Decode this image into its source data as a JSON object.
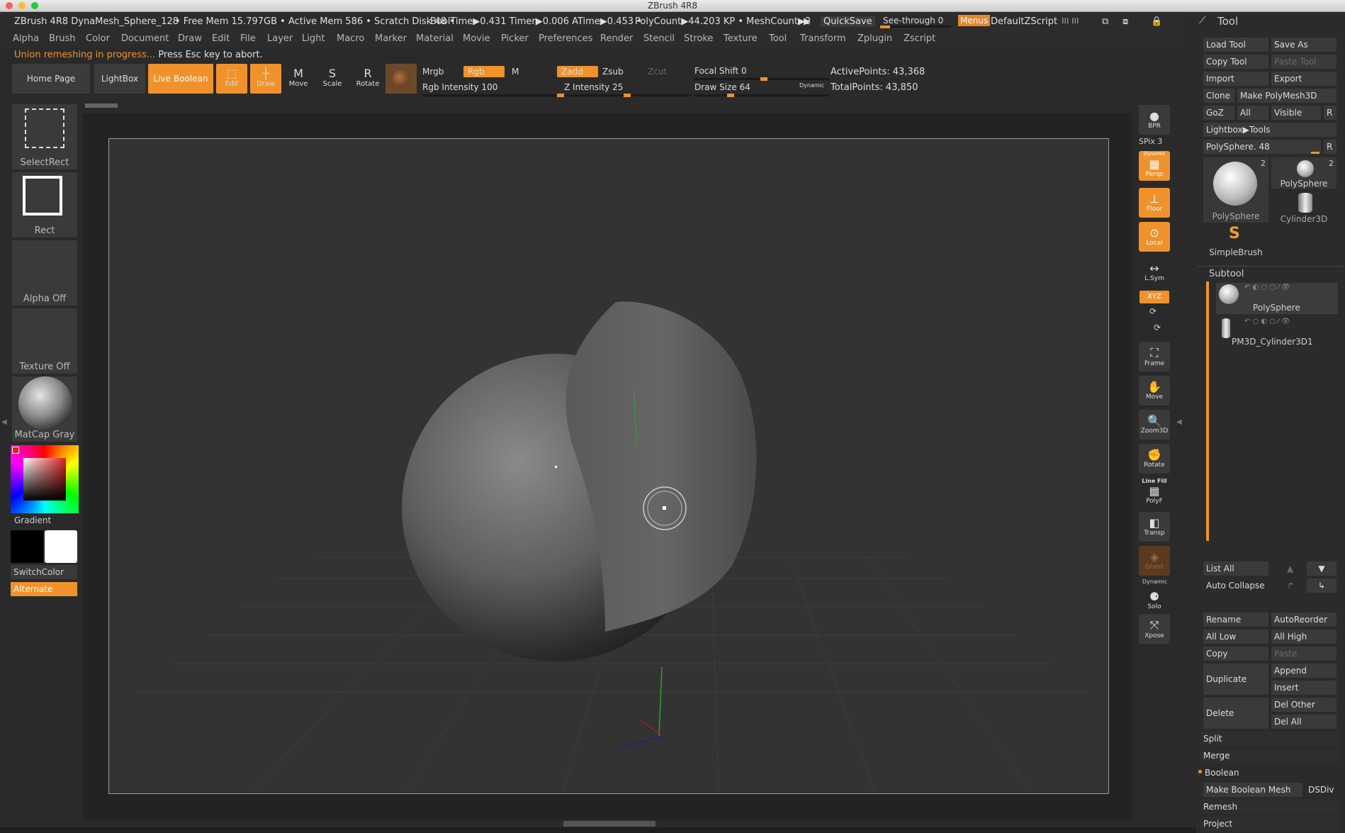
{
  "window": {
    "title": "ZBrush 4R8"
  },
  "infobar": {
    "doc": "ZBrush 4R8 DynaMesh_Sphere_128",
    "stats": "• Free Mem 15.797GB • Active Mem 586 • Scratch Disk 48 •",
    "timing": "BoolTime▶0.431 Timer▶0.006 ATime▶0.453 •",
    "polycount": "PolyCount▶44.203 KP • MeshCount▶2",
    "quicksave": "QuickSave",
    "seethrough": "See-through  0",
    "menus": "Menus",
    "script": "DefaultZScript"
  },
  "menubar": [
    "Alpha",
    "Brush",
    "Color",
    "Document",
    "Draw",
    "Edit",
    "File",
    "Layer",
    "Light",
    "Macro",
    "Marker",
    "Material",
    "Movie",
    "Picker",
    "Preferences",
    "Render",
    "Stencil",
    "Stroke",
    "Texture",
    "Tool",
    "Transform",
    "Zplugin",
    "Zscript"
  ],
  "status": {
    "warn": "Union remeshing in progress...",
    "rest": "Press Esc key to abort."
  },
  "toolbar": {
    "home": "Home Page",
    "lightbox": "LightBox",
    "liveboolean": "Live Boolean",
    "edit": "Edit",
    "draw": "Draw",
    "move": "Move",
    "scale": "Scale",
    "rotate": "Rotate",
    "mrgb": "Mrgb",
    "rgb": "Rgb",
    "m": "M",
    "zadd": "Zadd",
    "zsub": "Zsub",
    "zcut": "Zcut",
    "rgb_intensity": "Rgb Intensity 100",
    "z_intensity": "Z Intensity 25",
    "focal_shift": "Focal Shift 0",
    "draw_size": "Draw Size 64",
    "dynamic": "Dynamic",
    "active_points": "ActivePoints: 43,368",
    "total_points": "TotalPoints: 43,850"
  },
  "leftcol": {
    "selectrect": "SelectRect",
    "rect": "Rect",
    "alpha": "Alpha Off",
    "texture": "Texture Off",
    "material": "MatCap Gray",
    "gradient": "Gradient",
    "switchcolor": "SwitchColor",
    "alternate": "Alternate"
  },
  "rightdock": {
    "bpr": "BPR",
    "spix": "SPix 3",
    "persp": "Persp",
    "dynamic": "Dynamic",
    "floor": "Floor",
    "local": "Local",
    "lsym": "L.Sym",
    "xyz": "XYZ",
    "frame": "Frame",
    "move": "Move",
    "zoom3d": "Zoom3D",
    "rotate": "Rotate",
    "linefill": "Line Fill",
    "polyf": "PolyF",
    "transp": "Transp",
    "ghost": "Ghost",
    "solo": "Solo",
    "xpose": "Xpose"
  },
  "toolpanel": {
    "header": "Tool",
    "load": "Load Tool",
    "saveas": "Save As",
    "copytool": "Copy Tool",
    "pastetool": "Paste Tool",
    "import": "Import",
    "export": "Export",
    "clone": "Clone",
    "makepm": "Make PolyMesh3D",
    "goz": "GoZ",
    "all": "All",
    "visible": "Visible",
    "r": "R",
    "lightbox_tools": "Lightbox▶Tools",
    "polysphere_slider": "PolySphere. 48",
    "thumb1": "PolySphere",
    "thumb1_count": "2",
    "thumb2": "PolySphere",
    "thumb2_count": "2",
    "thumb3": "Cylinder3D",
    "thumb4": "SimpleBrush",
    "subtool": "Subtool",
    "sub1": "PolySphere",
    "sub2": "PM3D_Cylinder3D1",
    "listall": "List All",
    "autocollapse": "Auto Collapse",
    "rename": "Rename",
    "autoreorder": "AutoReorder",
    "alllow": "All Low",
    "allhigh": "All High",
    "copy": "Copy",
    "paste": "Paste",
    "duplicate": "Duplicate",
    "append": "Append",
    "insert": "Insert",
    "delete": "Delete",
    "delother": "Del Other",
    "delall": "Del All",
    "split": "Split",
    "merge": "Merge",
    "boolean": "Boolean",
    "makeboolean": "Make Boolean Mesh",
    "dsdiv": "DSDiv",
    "remesh": "Remesh",
    "project": "Project"
  }
}
